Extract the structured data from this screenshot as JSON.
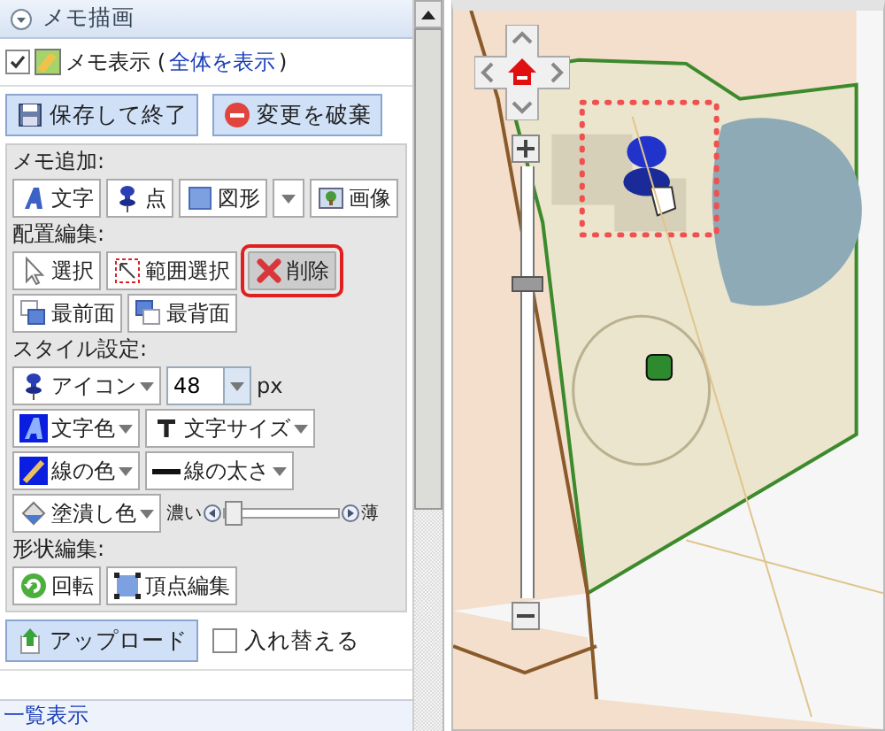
{
  "panel": {
    "title": "メモ描画",
    "expanded": true
  },
  "display": {
    "label": "メモ表示 (",
    "link": "全体を表示",
    "close": ")",
    "checked": true
  },
  "actions": [
    {
      "label": "保存して終了"
    },
    {
      "label": "変更を破棄"
    }
  ],
  "sections": [
    {
      "title": "メモ追加:",
      "rows": [
        [
          {
            "kind": "button",
            "label": "文字",
            "selected": false
          },
          {
            "kind": "button",
            "label": "点",
            "selected": false
          },
          {
            "kind": "split",
            "label": "図形",
            "selected": false
          },
          {
            "kind": "button",
            "label": "画像",
            "selected": false
          }
        ]
      ]
    },
    {
      "title": "配置編集:",
      "rows": [
        [
          {
            "kind": "button",
            "label": "選択",
            "selected": false
          },
          {
            "kind": "button",
            "label": "範囲選択",
            "selected": false
          },
          {
            "kind": "button",
            "label": "削除",
            "selected": true
          }
        ],
        [
          {
            "kind": "button",
            "label": "最前面",
            "selected": false
          },
          {
            "kind": "button",
            "label": "最背面",
            "selected": false
          }
        ]
      ]
    },
    {
      "title": "スタイル設定:",
      "rows": [
        [
          {
            "kind": "dropdown",
            "label": "アイコン"
          },
          {
            "kind": "combo",
            "value": "48",
            "unit": "px"
          }
        ],
        [
          {
            "kind": "dropdown",
            "label": "文字色"
          },
          {
            "kind": "dropdown",
            "label": "文字サイズ"
          }
        ],
        [
          {
            "kind": "dropdown",
            "label": "線の色"
          },
          {
            "kind": "dropdown",
            "label": "線の太さ"
          }
        ],
        [
          {
            "kind": "dropdown",
            "label": "塗潰し色"
          },
          {
            "kind": "slider",
            "min_label": "濃い",
            "max_label": "薄",
            "level": 0.08
          }
        ]
      ]
    },
    {
      "title": "形状編集:",
      "rows": [
        [
          {
            "kind": "button",
            "label": "回転",
            "selected": false
          },
          {
            "kind": "button",
            "label": "頂点編集",
            "selected": false
          }
        ]
      ]
    }
  ],
  "upload": {
    "label": "アップロード"
  },
  "swap": {
    "label": "入れ替える",
    "checked": false
  },
  "footer": {
    "link": "一覧表示"
  },
  "map": {
    "kind": "picture",
    "zoom": {
      "level": 0.73
    }
  }
}
